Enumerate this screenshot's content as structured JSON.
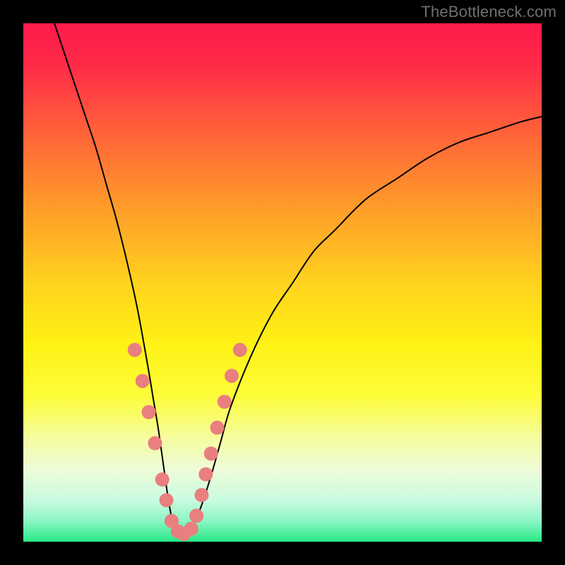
{
  "watermark": "TheBottleneck.com",
  "chart_data": {
    "type": "line",
    "title": "",
    "xlabel": "",
    "ylabel": "",
    "xlim": [
      0,
      100
    ],
    "ylim": [
      0,
      100
    ],
    "grid": false,
    "legend": false,
    "background_gradient": {
      "stops": [
        {
          "offset": 0.0,
          "color": "#ff1a4b"
        },
        {
          "offset": 0.08,
          "color": "#ff2a48"
        },
        {
          "offset": 0.2,
          "color": "#ff5e3a"
        },
        {
          "offset": 0.35,
          "color": "#ff9a2a"
        },
        {
          "offset": 0.5,
          "color": "#ffd21e"
        },
        {
          "offset": 0.62,
          "color": "#fff215"
        },
        {
          "offset": 0.72,
          "color": "#fdfd3a"
        },
        {
          "offset": 0.8,
          "color": "#f6fca0"
        },
        {
          "offset": 0.86,
          "color": "#eefcd8"
        },
        {
          "offset": 0.92,
          "color": "#c9fbe0"
        },
        {
          "offset": 0.96,
          "color": "#8cf6c5"
        },
        {
          "offset": 1.0,
          "color": "#27e985"
        }
      ]
    },
    "series": [
      {
        "name": "bottleneck-curve",
        "color": "#000000",
        "stroke_width": 2,
        "x": [
          6,
          8,
          10,
          12,
          14,
          16,
          18,
          20,
          22,
          24,
          25,
          26,
          27,
          28,
          29,
          30,
          31,
          32,
          34,
          36,
          38,
          40,
          44,
          48,
          52,
          56,
          60,
          66,
          72,
          78,
          84,
          90,
          96,
          100
        ],
        "y": [
          100,
          94,
          88,
          82,
          76,
          69,
          62,
          54,
          45,
          34,
          28,
          22,
          15,
          8,
          3,
          1,
          1,
          2,
          6,
          12,
          19,
          26,
          36,
          44,
          50,
          56,
          60,
          66,
          70,
          74,
          77,
          79,
          81,
          82
        ]
      },
      {
        "name": "highlight-dots",
        "type": "scatter",
        "color": "#e97f7f",
        "marker_radius": 10,
        "x": [
          21.5,
          23.0,
          24.2,
          25.4,
          26.8,
          27.6,
          28.6,
          29.8,
          31.0,
          32.4,
          33.4,
          34.4,
          35.2,
          36.2,
          37.4,
          38.8,
          40.2,
          41.8
        ],
        "y": [
          37.0,
          31.0,
          25.0,
          19.0,
          12.0,
          8.0,
          4.0,
          2.0,
          1.5,
          2.5,
          5.0,
          9.0,
          13.0,
          17.0,
          22.0,
          27.0,
          32.0,
          37.0
        ]
      }
    ]
  }
}
